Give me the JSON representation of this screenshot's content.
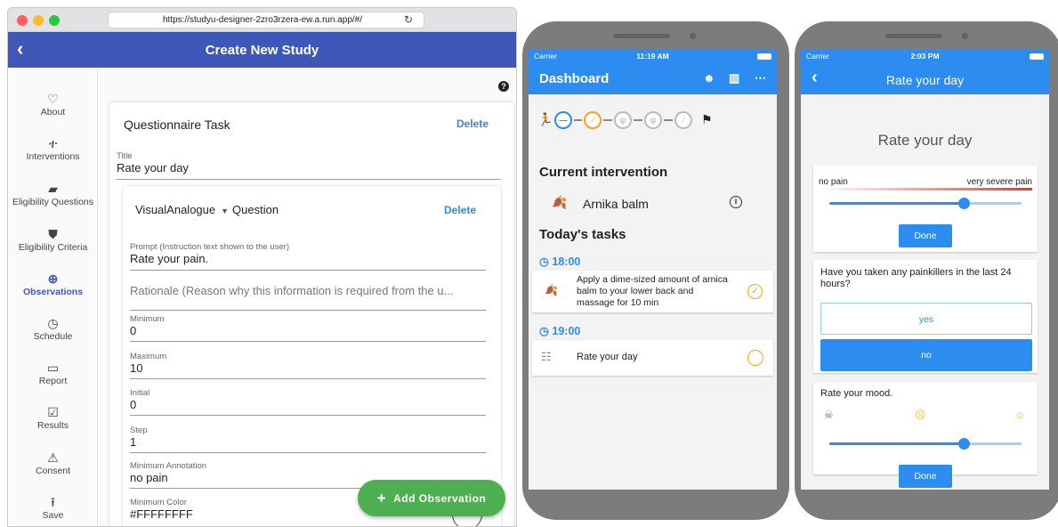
{
  "browser": {
    "url": "https://studyu-designer-2zro3rzera-ew.a.run.app/#/",
    "page_title": "Create New Study"
  },
  "sidebar": {
    "items": [
      {
        "label": "About",
        "icon": "♡"
      },
      {
        "label": "Interventions",
        "icon": "🚶"
      },
      {
        "label": "Eligibility Questions",
        "icon": "▰"
      },
      {
        "label": "Eligibility Criteria",
        "icon": "⛊"
      },
      {
        "label": "Observations",
        "icon": "⊕"
      },
      {
        "label": "Schedule",
        "icon": "◷"
      },
      {
        "label": "Report",
        "icon": "📋"
      },
      {
        "label": "Results",
        "icon": "☑"
      },
      {
        "label": "Consent",
        "icon": "⚠"
      },
      {
        "label": "Save",
        "icon": "⭱"
      }
    ]
  },
  "task": {
    "heading": "Questionnaire Task",
    "delete_label": "Delete",
    "title_label": "Title",
    "title_value": "Rate your day",
    "question": {
      "type": "VisualAnalogue",
      "type_suffix": "Question",
      "delete_label": "Delete",
      "prompt_label": "Prompt (Instruction text shown to the user)",
      "prompt_value": "Rate your pain.",
      "rationale_placeholder": "Rationale (Reason why this information is required from the u...",
      "fields": [
        {
          "label": "Minimum",
          "value": "0"
        },
        {
          "label": "Maximum",
          "value": "10"
        },
        {
          "label": "Initial",
          "value": "0"
        },
        {
          "label": "Step",
          "value": "1"
        },
        {
          "label": "Minimum Annotation",
          "value": "no pain"
        },
        {
          "label": "Minimum Color",
          "value": "#FFFFFFFF"
        }
      ]
    },
    "add_button": "Add Observation"
  },
  "phone1": {
    "carrier": "Carrier",
    "time": "11:19 AM",
    "title": "Dashboard",
    "current_intervention_title": "Current intervention",
    "intervention_name": "Arnika balm",
    "todays_tasks_title": "Today's tasks",
    "tasks": [
      {
        "time": "18:00",
        "text": "Apply a dime-sized amount of arnica balm to your lower back and massage for 10 min",
        "done": true
      },
      {
        "time": "19:00",
        "text": "Rate your day",
        "done": false
      }
    ]
  },
  "phone2": {
    "carrier": "Carrier",
    "time": "2:03 PM",
    "title": "Rate your day",
    "heading": "Rate your day",
    "pain": {
      "min_label": "no pain",
      "max_label": "very severe pain",
      "value": 7,
      "max": 10,
      "done_label": "Done"
    },
    "painkillers": {
      "question": "Have you taken any painkillers in the last 24 hours?",
      "options": [
        "yes",
        "no"
      ],
      "selected": "no"
    },
    "mood": {
      "question": "Rate your mood.",
      "value": 0.7,
      "done_label": "Done"
    },
    "accent": "#2d8cf0"
  }
}
